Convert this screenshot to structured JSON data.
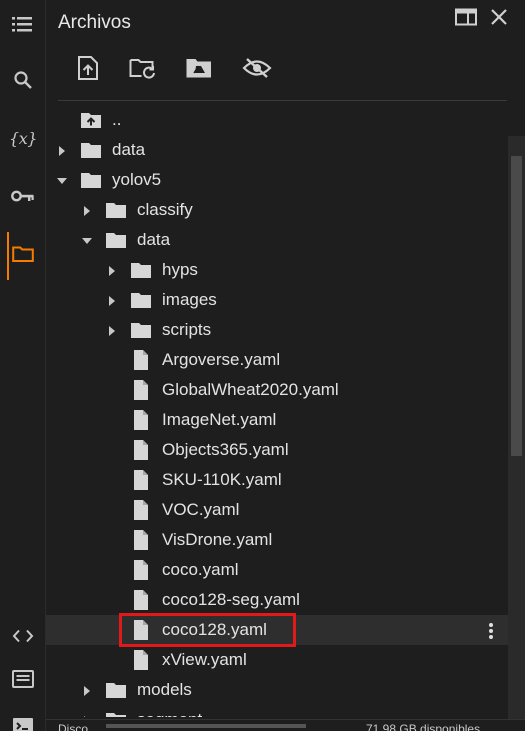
{
  "header": {
    "title": "Archivos"
  },
  "rail": {
    "items": [
      {
        "icon": "list-icon"
      },
      {
        "icon": "search-icon"
      },
      {
        "icon": "variables-icon",
        "glyph": "{x}"
      },
      {
        "icon": "key-icon"
      },
      {
        "icon": "folder-icon",
        "active": true
      },
      {
        "icon": "code-icon"
      },
      {
        "icon": "terminal-list-icon"
      },
      {
        "icon": "terminal-icon"
      }
    ]
  },
  "toolbar": {
    "items": [
      "upload-file-icon",
      "refresh-folder-icon",
      "mount-drive-icon",
      "hide-hidden-files-icon"
    ]
  },
  "tree": {
    "rows": [
      {
        "label": "..",
        "type": "up",
        "depth": 0
      },
      {
        "label": "data",
        "type": "folder",
        "depth": 0,
        "expanded": false
      },
      {
        "label": "yolov5",
        "type": "folder",
        "depth": 0,
        "expanded": true
      },
      {
        "label": "classify",
        "type": "folder",
        "depth": 1,
        "expanded": false
      },
      {
        "label": "data",
        "type": "folder",
        "depth": 1,
        "expanded": true
      },
      {
        "label": "hyps",
        "type": "folder",
        "depth": 2,
        "expanded": false
      },
      {
        "label": "images",
        "type": "folder",
        "depth": 2,
        "expanded": false
      },
      {
        "label": "scripts",
        "type": "folder",
        "depth": 2,
        "expanded": false
      },
      {
        "label": "Argoverse.yaml",
        "type": "file",
        "depth": 2
      },
      {
        "label": "GlobalWheat2020.yaml",
        "type": "file",
        "depth": 2
      },
      {
        "label": "ImageNet.yaml",
        "type": "file",
        "depth": 2
      },
      {
        "label": "Objects365.yaml",
        "type": "file",
        "depth": 2
      },
      {
        "label": "SKU-110K.yaml",
        "type": "file",
        "depth": 2
      },
      {
        "label": "VOC.yaml",
        "type": "file",
        "depth": 2
      },
      {
        "label": "VisDrone.yaml",
        "type": "file",
        "depth": 2
      },
      {
        "label": "coco.yaml",
        "type": "file",
        "depth": 2
      },
      {
        "label": "coco128-seg.yaml",
        "type": "file",
        "depth": 2
      },
      {
        "label": "coco128.yaml",
        "type": "file",
        "depth": 2,
        "selected": true
      },
      {
        "label": "xView.yaml",
        "type": "file",
        "depth": 2
      },
      {
        "label": "models",
        "type": "folder",
        "depth": 1,
        "expanded": false
      },
      {
        "label": "segment",
        "type": "folder",
        "depth": 1,
        "expanded": false
      }
    ]
  },
  "status": {
    "left": "Disco",
    "right": "71.98 GB disponibles"
  },
  "colors": {
    "accent": "#f57c00",
    "highlight": "#e0191b",
    "background": "#1e1e1e",
    "selected_row": "#2e2e2e"
  }
}
